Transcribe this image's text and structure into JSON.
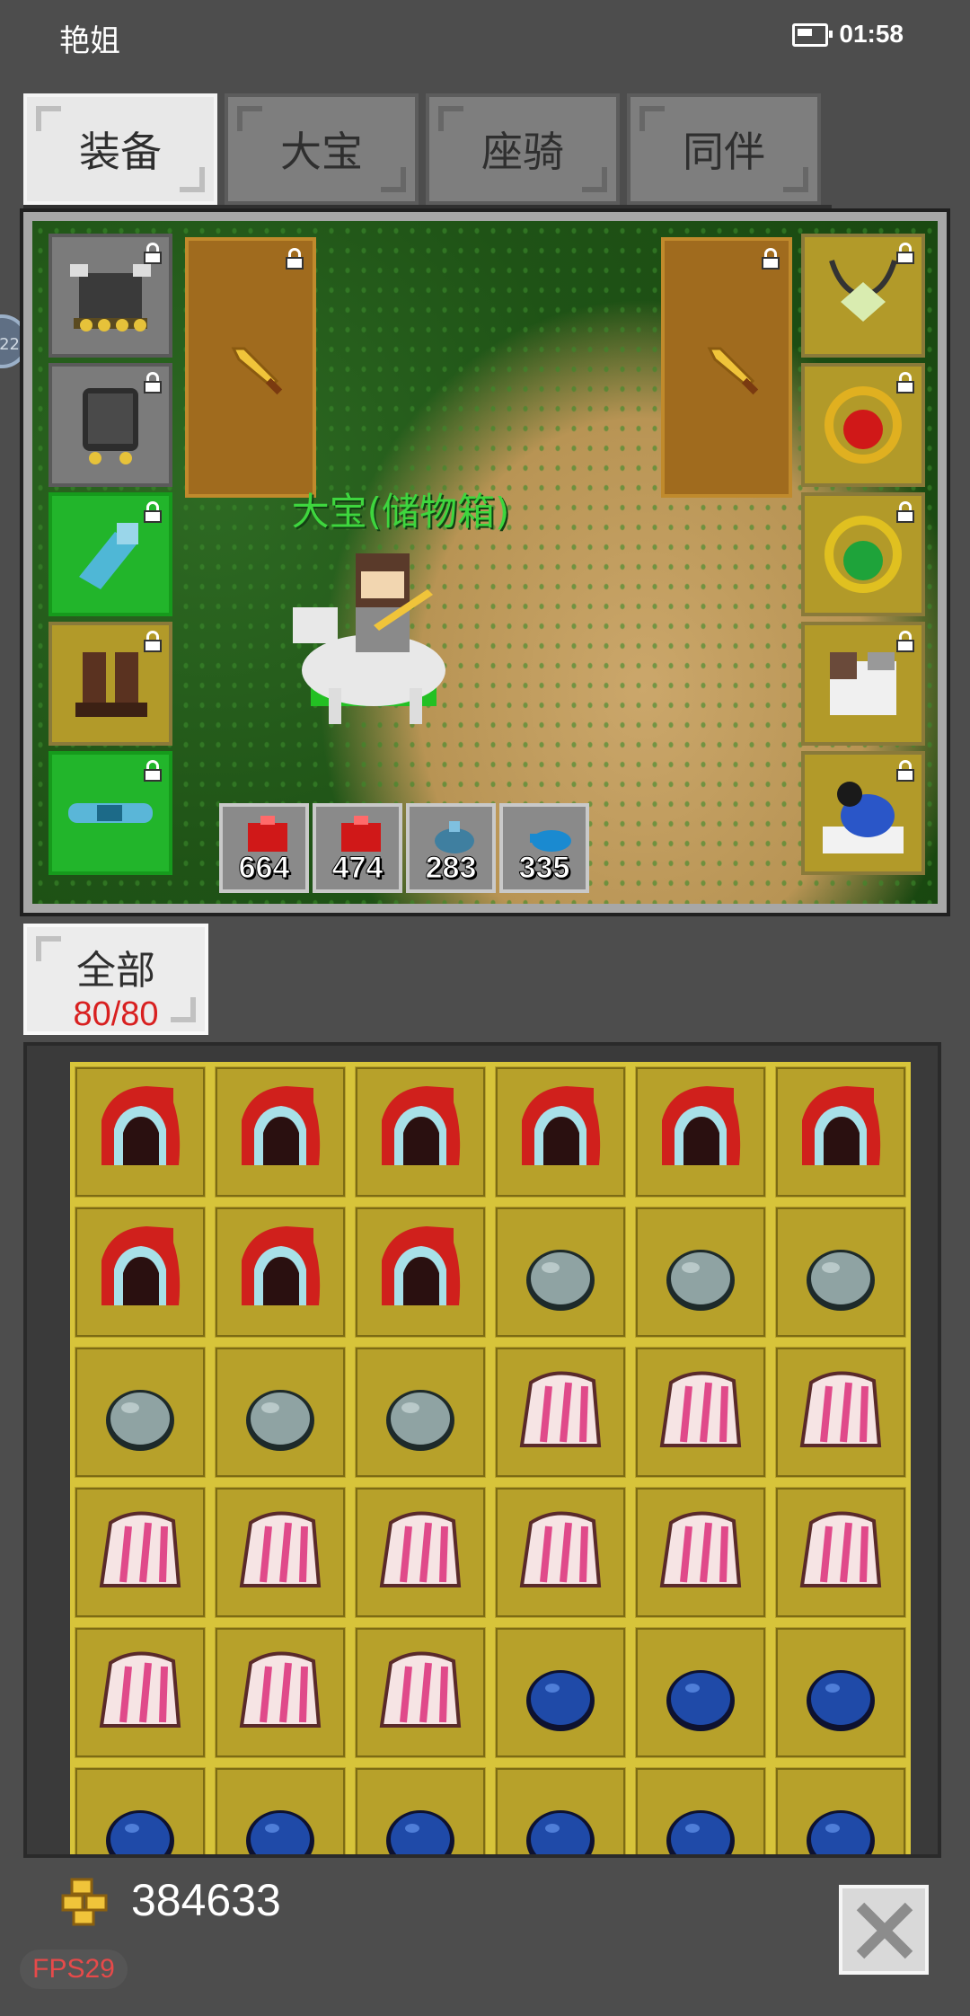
{
  "status_bar": {
    "user_name": "艳姐",
    "time": "01:58"
  },
  "side_bubble": {
    "text": "22"
  },
  "tabs": [
    {
      "label": "装备",
      "active": true
    },
    {
      "label": "大宝",
      "active": false
    },
    {
      "label": "座骑",
      "active": false
    },
    {
      "label": "同伴",
      "active": false
    }
  ],
  "character": {
    "name": "大宝(储物箱)"
  },
  "equipment_left": [
    {
      "icon": "horned-helmet-icon",
      "bg": "gray"
    },
    {
      "icon": "dark-armor-icon",
      "bg": "gray"
    },
    {
      "icon": "blue-gauntlet-icon",
      "bg": "green"
    },
    {
      "icon": "leather-boots-icon",
      "bg": "gold"
    },
    {
      "icon": "blue-belt-icon",
      "bg": "green"
    }
  ],
  "equipment_right": [
    {
      "icon": "horned-amulet-icon",
      "bg": "gold"
    },
    {
      "icon": "ruby-ring-icon",
      "bg": "gold"
    },
    {
      "icon": "emerald-ring-icon",
      "bg": "gold"
    },
    {
      "icon": "wolf-mount-icon",
      "bg": "gold"
    },
    {
      "icon": "bird-companion-icon",
      "bg": "gold"
    }
  ],
  "weapons": [
    {
      "icon": "golden-sword-icon"
    },
    {
      "icon": "golden-sword-icon"
    }
  ],
  "potions": [
    {
      "icon": "red-potion-icon",
      "count": "664"
    },
    {
      "icon": "red-potion-icon",
      "count": "474"
    },
    {
      "icon": "blue-potion-icon",
      "count": "283"
    },
    {
      "icon": "blue-potion-icon",
      "count": "335"
    }
  ],
  "filter": {
    "label": "全部",
    "count": "80/80"
  },
  "inventory": [
    "red-hood-icon",
    "red-hood-icon",
    "red-hood-icon",
    "red-hood-icon",
    "red-hood-icon",
    "red-hood-icon",
    "red-hood-icon",
    "red-hood-icon",
    "red-hood-icon",
    "gray-stone-icon",
    "gray-stone-icon",
    "gray-stone-icon",
    "gray-stone-icon",
    "gray-stone-icon",
    "gray-stone-icon",
    "pink-claw-icon",
    "pink-claw-icon",
    "pink-claw-icon",
    "pink-claw-icon",
    "pink-claw-icon",
    "pink-claw-icon",
    "pink-claw-icon",
    "pink-claw-icon",
    "pink-claw-icon",
    "pink-claw-icon",
    "pink-claw-icon",
    "pink-claw-icon",
    "blue-stone-icon",
    "blue-stone-icon",
    "blue-stone-icon",
    "blue-stone-icon",
    "blue-stone-icon",
    "blue-stone-icon",
    "blue-stone-icon",
    "blue-stone-icon",
    "blue-stone-icon"
  ],
  "footer": {
    "gold_amount": "384633",
    "fps": "FPS29"
  },
  "colors": {
    "slot_gold": "#b29a29",
    "slot_green": "#22b52b",
    "slot_gray": "#7b7b7b",
    "count_red": "#d82020",
    "name_green": "#3ed63e"
  }
}
